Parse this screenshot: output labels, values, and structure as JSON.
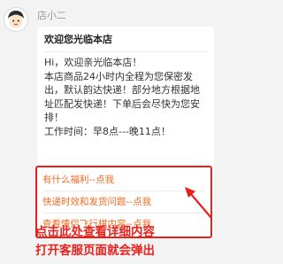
{
  "agent": {
    "name": "店小二"
  },
  "message": {
    "title": "欢迎您光临本店",
    "body": "Hi，欢迎亲光临本店！\n本店商品24小时内全程为您保密发出，默认韵达快递！部分地方根据地址匹配发快递！下单后会尽快为您安排！\n工作时间：早8点---晚11点！"
  },
  "quick_links": [
    {
      "label": "有什么福利--点我"
    },
    {
      "label": "快递时效和发货问题--点我"
    },
    {
      "label": "查看情侣飞行棋内容--点我"
    }
  ],
  "annotation": {
    "text": "点击此处查看详细内容\n打开客服页面就会弹出"
  },
  "colors": {
    "accent": "#e8211c",
    "link": "#f26a21",
    "background": "#f3f3f3",
    "bubble": "#ffffff"
  },
  "icons": {
    "avatar": "shopkeeper-avatar-icon",
    "arrow": "red-arrow-icon"
  }
}
